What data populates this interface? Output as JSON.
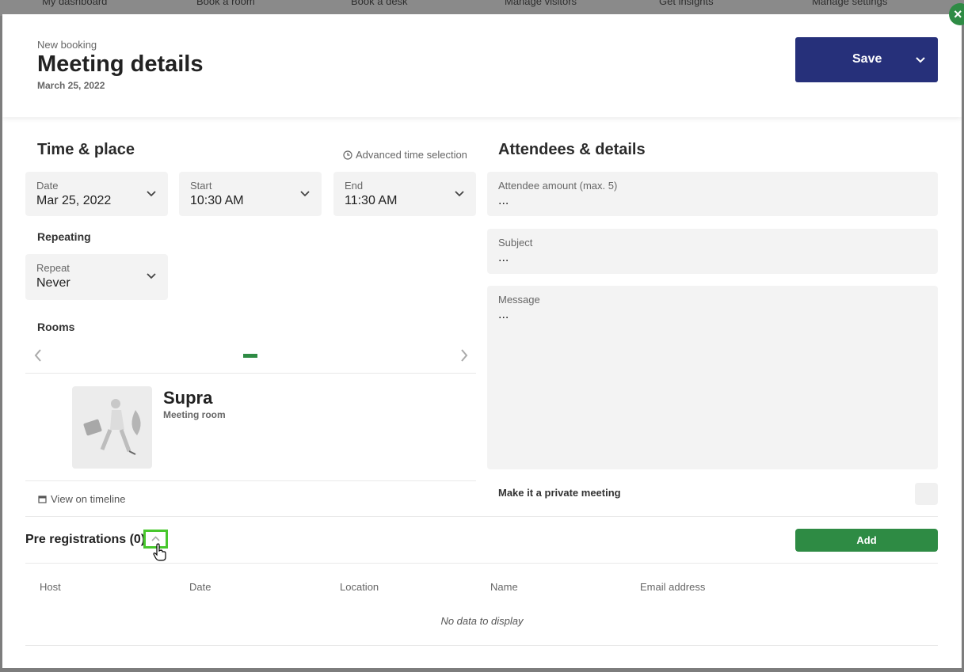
{
  "background_nav": [
    "My dashboard",
    "Book a room",
    "Book a desk",
    "Manage visitors",
    "Get insights",
    "Manage settings"
  ],
  "close_icon": "×",
  "header": {
    "kicker": "New booking",
    "title": "Meeting details",
    "date": "March 25, 2022",
    "save_label": "Save"
  },
  "time_place": {
    "title": "Time & place",
    "advanced_link": "Advanced time selection",
    "date": {
      "label": "Date",
      "value": "Mar 25, 2022"
    },
    "start": {
      "label": "Start",
      "value": "10:30 AM"
    },
    "end": {
      "label": "End",
      "value": "11:30 AM"
    },
    "repeating_label": "Repeating",
    "repeat": {
      "label": "Repeat",
      "value": "Never"
    },
    "rooms_label": "Rooms",
    "room": {
      "name": "Supra",
      "type": "Meeting room"
    },
    "timeline_link": "View on timeline"
  },
  "attendees": {
    "title": "Attendees & details",
    "amount": {
      "label": "Attendee amount (max. 5)",
      "value": "..."
    },
    "subject": {
      "label": "Subject",
      "value": "..."
    },
    "message": {
      "label": "Message",
      "value": "..."
    },
    "private_label": "Make it a private meeting"
  },
  "pre_registrations": {
    "title": "Pre registrations (0)",
    "add_label": "Add",
    "columns": [
      "Host",
      "Date",
      "Location",
      "Name",
      "Email address"
    ],
    "empty_text": "No data to display"
  },
  "colors": {
    "primary": "#26307a",
    "accent": "#2e8b44",
    "highlight": "#48c72d"
  },
  "icons": [
    "close-icon",
    "chevron-down-icon",
    "clock-icon",
    "chevron-left-icon",
    "chevron-right-icon",
    "calendar-icon",
    "chevron-up-icon",
    "hand-cursor-icon"
  ]
}
